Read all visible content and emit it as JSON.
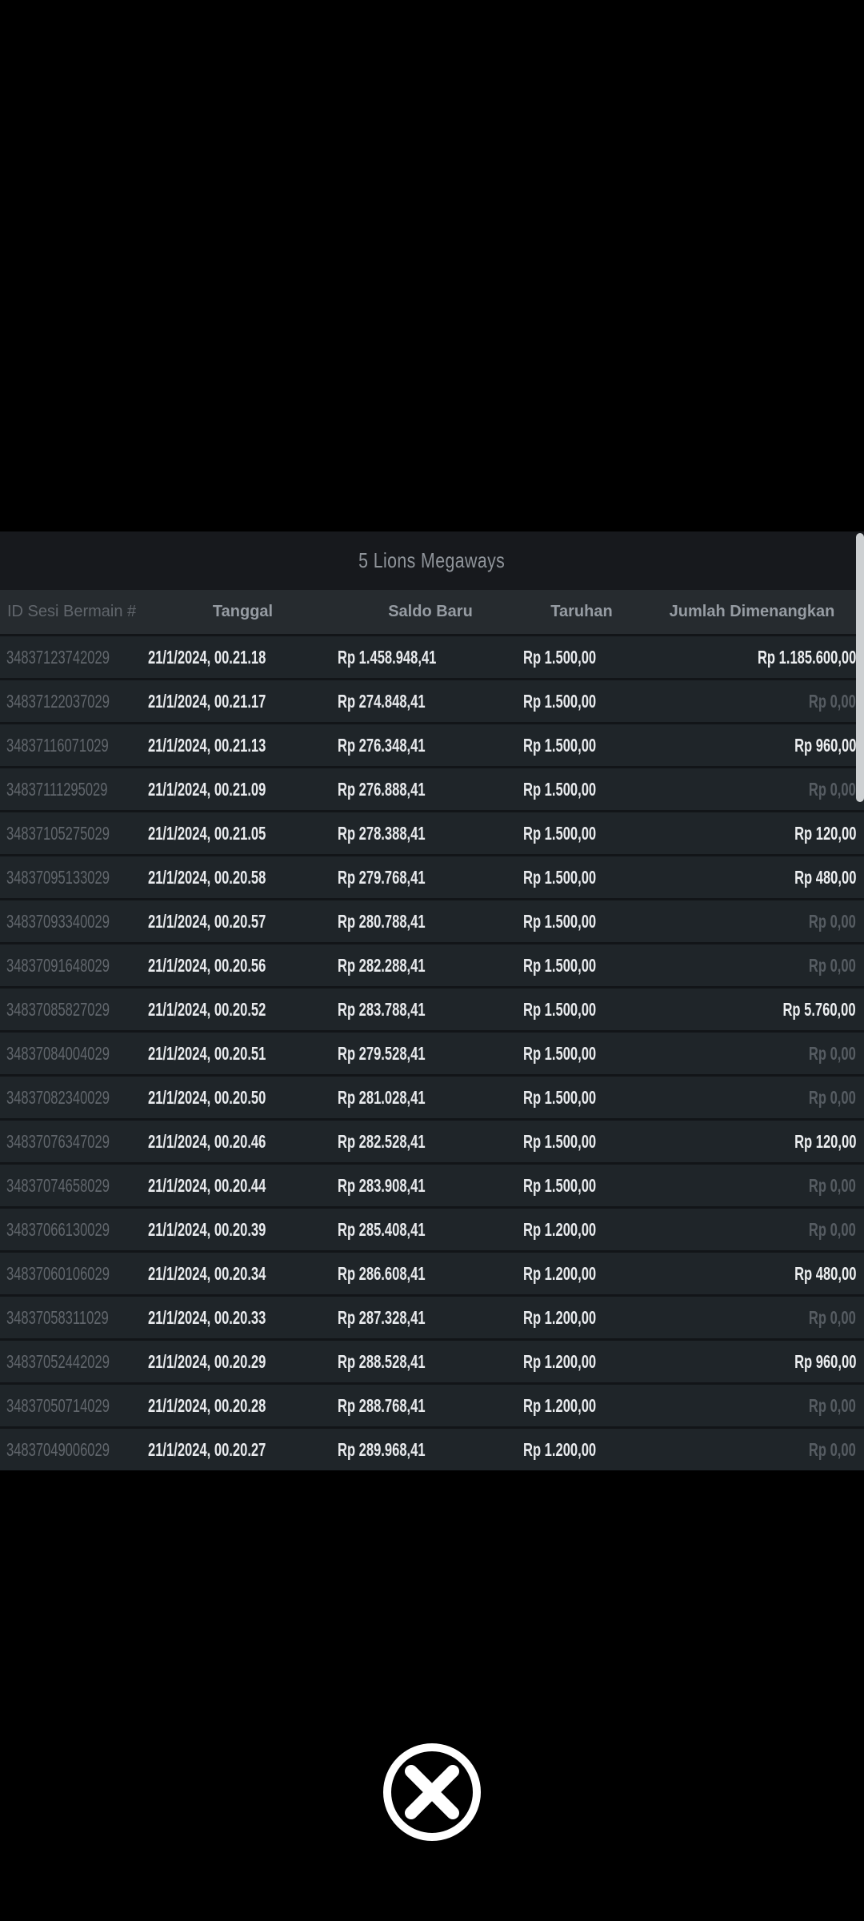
{
  "modal": {
    "title": "5 Lions Megaways",
    "columns": [
      {
        "label": "ID Sesi Bermain #"
      },
      {
        "label": "Tanggal"
      },
      {
        "label": "Saldo Baru"
      },
      {
        "label": "Taruhan"
      },
      {
        "label": "Jumlah Dimenangkan"
      }
    ],
    "zero_value": "Rp 0,00",
    "rows": [
      {
        "id": "34837123742029",
        "tanggal": "21/1/2024, 00.21.18",
        "saldo": "Rp 1.458.948,41",
        "taruhan": "Rp 1.500,00",
        "jumlah": "Rp 1.185.600,00"
      },
      {
        "id": "34837122037029",
        "tanggal": "21/1/2024, 00.21.17",
        "saldo": "Rp 274.848,41",
        "taruhan": "Rp 1.500,00",
        "jumlah": "Rp 0,00"
      },
      {
        "id": "34837116071029",
        "tanggal": "21/1/2024, 00.21.13",
        "saldo": "Rp 276.348,41",
        "taruhan": "Rp 1.500,00",
        "jumlah": "Rp 960,00"
      },
      {
        "id": "34837111295029",
        "tanggal": "21/1/2024, 00.21.09",
        "saldo": "Rp 276.888,41",
        "taruhan": "Rp 1.500,00",
        "jumlah": "Rp 0,00"
      },
      {
        "id": "34837105275029",
        "tanggal": "21/1/2024, 00.21.05",
        "saldo": "Rp 278.388,41",
        "taruhan": "Rp 1.500,00",
        "jumlah": "Rp 120,00"
      },
      {
        "id": "34837095133029",
        "tanggal": "21/1/2024, 00.20.58",
        "saldo": "Rp 279.768,41",
        "taruhan": "Rp 1.500,00",
        "jumlah": "Rp 480,00"
      },
      {
        "id": "34837093340029",
        "tanggal": "21/1/2024, 00.20.57",
        "saldo": "Rp 280.788,41",
        "taruhan": "Rp 1.500,00",
        "jumlah": "Rp 0,00"
      },
      {
        "id": "34837091648029",
        "tanggal": "21/1/2024, 00.20.56",
        "saldo": "Rp 282.288,41",
        "taruhan": "Rp 1.500,00",
        "jumlah": "Rp 0,00"
      },
      {
        "id": "34837085827029",
        "tanggal": "21/1/2024, 00.20.52",
        "saldo": "Rp 283.788,41",
        "taruhan": "Rp 1.500,00",
        "jumlah": "Rp 5.760,00"
      },
      {
        "id": "34837084004029",
        "tanggal": "21/1/2024, 00.20.51",
        "saldo": "Rp 279.528,41",
        "taruhan": "Rp 1.500,00",
        "jumlah": "Rp 0,00"
      },
      {
        "id": "34837082340029",
        "tanggal": "21/1/2024, 00.20.50",
        "saldo": "Rp 281.028,41",
        "taruhan": "Rp 1.500,00",
        "jumlah": "Rp 0,00"
      },
      {
        "id": "34837076347029",
        "tanggal": "21/1/2024, 00.20.46",
        "saldo": "Rp 282.528,41",
        "taruhan": "Rp 1.500,00",
        "jumlah": "Rp 120,00"
      },
      {
        "id": "34837074658029",
        "tanggal": "21/1/2024, 00.20.44",
        "saldo": "Rp 283.908,41",
        "taruhan": "Rp 1.500,00",
        "jumlah": "Rp 0,00"
      },
      {
        "id": "34837066130029",
        "tanggal": "21/1/2024, 00.20.39",
        "saldo": "Rp 285.408,41",
        "taruhan": "Rp 1.200,00",
        "jumlah": "Rp 0,00"
      },
      {
        "id": "34837060106029",
        "tanggal": "21/1/2024, 00.20.34",
        "saldo": "Rp 286.608,41",
        "taruhan": "Rp 1.200,00",
        "jumlah": "Rp 480,00"
      },
      {
        "id": "34837058311029",
        "tanggal": "21/1/2024, 00.20.33",
        "saldo": "Rp 287.328,41",
        "taruhan": "Rp 1.200,00",
        "jumlah": "Rp 0,00"
      },
      {
        "id": "34837052442029",
        "tanggal": "21/1/2024, 00.20.29",
        "saldo": "Rp 288.528,41",
        "taruhan": "Rp 1.200,00",
        "jumlah": "Rp 960,00"
      },
      {
        "id": "34837050714029",
        "tanggal": "21/1/2024, 00.20.28",
        "saldo": "Rp 288.768,41",
        "taruhan": "Rp 1.200,00",
        "jumlah": "Rp 0,00"
      },
      {
        "id": "34837049006029",
        "tanggal": "21/1/2024, 00.20.27",
        "saldo": "Rp 289.968,41",
        "taruhan": "Rp 1.200,00",
        "jumlah": "Rp 0,00"
      }
    ]
  },
  "colors": {
    "page_bg": "#000000",
    "title_bar_bg": "#17191d",
    "header_bg": "#262b2f",
    "row_bg": "#1f2529",
    "value_text": "#e8eaed",
    "muted_text": "#61666c",
    "close_icon": "#ffffff",
    "scroll_thumb": "#cdd0d2"
  }
}
